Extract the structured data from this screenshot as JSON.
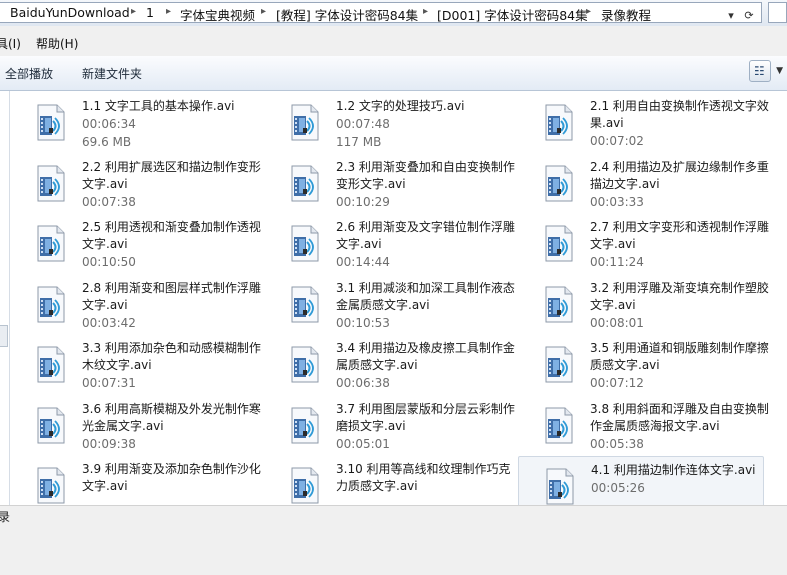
{
  "address": {
    "crumbs": [
      "BaiduYunDownload",
      "1",
      "字体宝典视频",
      "[教程] 字体设计密码84集",
      "[D001] 字体设计密码84集",
      "录像教程"
    ],
    "dropdown_glyph": "▾",
    "refresh_glyph": "⟳"
  },
  "menu": {
    "tools_fragment": "具(I)",
    "help": "帮助(H)"
  },
  "toolbar": {
    "play_all": "全部播放",
    "new_folder": "新建文件夹"
  },
  "status_fragment": "录",
  "files": [
    {
      "name_lines": [
        "1.1  文字工具的基本操作.avi"
      ],
      "duration": "00:06:34",
      "size": "69.6 MB",
      "selected": false
    },
    {
      "name_lines": [
        "1.2  文字的处理技巧.avi"
      ],
      "duration": "00:07:48",
      "size": "117 MB",
      "selected": false
    },
    {
      "name_lines": [
        "2.1  利用自由变换制作透视文字效",
        "果.avi"
      ],
      "duration": "00:07:02",
      "size": "",
      "selected": false
    },
    {
      "name_lines": [
        "2.2  利用扩展选区和描边制作变形",
        "文字.avi"
      ],
      "duration": "00:07:38",
      "size": "",
      "selected": false
    },
    {
      "name_lines": [
        "2.3  利用渐变叠加和自由变换制作",
        "变形文字.avi"
      ],
      "duration": "00:10:29",
      "size": "",
      "selected": false
    },
    {
      "name_lines": [
        "2.4  利用描边及扩展边缘制作多重",
        "描边文字.avi"
      ],
      "duration": "00:03:33",
      "size": "",
      "selected": false
    },
    {
      "name_lines": [
        "2.5  利用透视和渐变叠加制作透视",
        "文字.avi"
      ],
      "duration": "00:10:50",
      "size": "",
      "selected": false
    },
    {
      "name_lines": [
        "2.6  利用渐变及文字错位制作浮雕",
        "文字.avi"
      ],
      "duration": "00:14:44",
      "size": "",
      "selected": false
    },
    {
      "name_lines": [
        "2.7  利用文字变形和透视制作浮雕",
        "文字.avi"
      ],
      "duration": "00:11:24",
      "size": "",
      "selected": false
    },
    {
      "name_lines": [
        "2.8  利用渐变和图层样式制作浮雕",
        "文字.avi"
      ],
      "duration": "00:03:42",
      "size": "",
      "selected": false
    },
    {
      "name_lines": [
        "3.1  利用减淡和加深工具制作液态",
        "金属质感文字.avi"
      ],
      "duration": "00:10:53",
      "size": "",
      "selected": false
    },
    {
      "name_lines": [
        "3.2  利用浮雕及渐变填充制作塑胶",
        "文字.avi"
      ],
      "duration": "00:08:01",
      "size": "",
      "selected": false
    },
    {
      "name_lines": [
        "3.3  利用添加杂色和动感模糊制作",
        "木纹文字.avi"
      ],
      "duration": "00:07:31",
      "size": "",
      "selected": false
    },
    {
      "name_lines": [
        "3.4  利用描边及橡皮擦工具制作金",
        "属质感文字.avi"
      ],
      "duration": "00:06:38",
      "size": "",
      "selected": false
    },
    {
      "name_lines": [
        "3.5  利用通道和铜版雕刻制作摩擦",
        "质感文字.avi"
      ],
      "duration": "00:07:12",
      "size": "",
      "selected": false
    },
    {
      "name_lines": [
        "3.6  利用高斯模糊及外发光制作寒",
        "光金属文字.avi"
      ],
      "duration": "00:09:38",
      "size": "",
      "selected": false
    },
    {
      "name_lines": [
        "3.7  利用图层蒙版和分层云彩制作",
        "磨损文字.avi"
      ],
      "duration": "00:05:01",
      "size": "",
      "selected": false
    },
    {
      "name_lines": [
        "3.8  利用斜面和浮雕及自由变换制",
        "作金属质感海报文字.avi"
      ],
      "duration": "00:05:38",
      "size": "",
      "selected": false
    },
    {
      "name_lines": [
        "3.9  利用渐变及添加杂色制作沙化",
        "文字.avi"
      ],
      "duration": "",
      "size": "",
      "selected": false
    },
    {
      "name_lines": [
        "3.10  利用等高线和纹理制作巧克",
        "力质感文字.avi"
      ],
      "duration": "",
      "size": "",
      "selected": false
    },
    {
      "name_lines": [
        "4.1  利用描边制作连体文字.avi"
      ],
      "duration": "00:05:26",
      "size": "",
      "selected": true
    }
  ]
}
